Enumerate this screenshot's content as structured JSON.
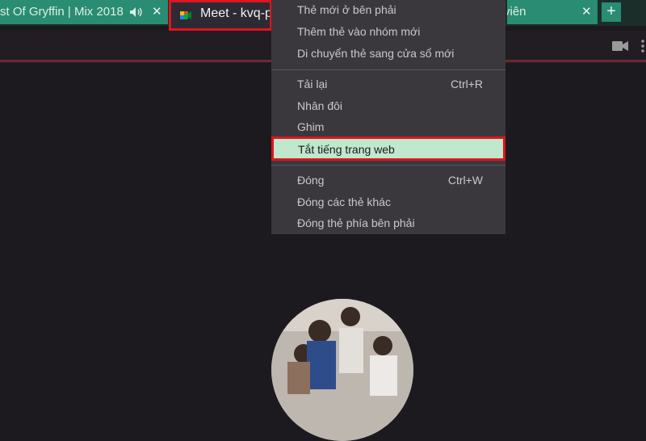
{
  "tabs": {
    "left": {
      "title": "st Of Gryffin | Mix 2018",
      "audio_icon": "speaker-icon",
      "close_glyph": "✕"
    },
    "active": {
      "title": "Meet - kvq-p",
      "favicon": "google-meet-icon"
    },
    "right": {
      "title": "viên",
      "close_glyph": "✕"
    },
    "new_tab_glyph": "+"
  },
  "toolbar": {
    "camera_icon": "camera-icon",
    "more_icon": "more-vert-icon"
  },
  "menu": {
    "items": [
      {
        "label": "Thẻ mới ở bên phải",
        "shortcut": ""
      },
      {
        "label": "Thêm thẻ vào nhóm mới",
        "shortcut": ""
      },
      {
        "label": "Di chuyển thẻ sang cửa sổ mới",
        "shortcut": ""
      },
      {
        "label": "Tải lại",
        "shortcut": "Ctrl+R"
      },
      {
        "label": "Nhân đôi",
        "shortcut": ""
      },
      {
        "label": "Ghim",
        "shortcut": ""
      },
      {
        "label": "Tắt tiếng trang web",
        "shortcut": ""
      },
      {
        "label": "Đóng",
        "shortcut": "Ctrl+W"
      },
      {
        "label": "Đóng các thẻ khác",
        "shortcut": ""
      },
      {
        "label": "Đóng thẻ phía bên phải",
        "shortcut": ""
      }
    ]
  },
  "colors": {
    "accent_red": "#e0141e",
    "tab_green": "#2a8c72",
    "highlight_green": "#bfe8cd"
  }
}
